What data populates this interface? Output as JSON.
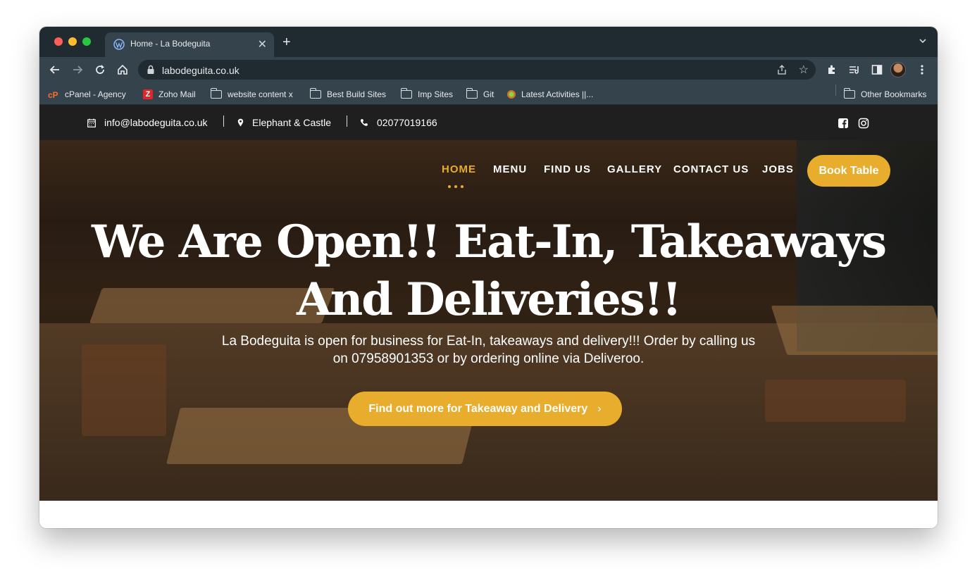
{
  "browser": {
    "tab_title": "Home - La Bodeguita",
    "new_tab_symbol": "+",
    "close_symbol": "✕",
    "url": "labodeguita.co.uk",
    "star_symbol": "☆",
    "bookmarks": [
      {
        "label": "cPanel - Agency",
        "icon": "cpanel-icon"
      },
      {
        "label": "Zoho Mail",
        "icon": "zoho-icon"
      },
      {
        "label": "website content x",
        "icon": "folder-icon"
      },
      {
        "label": "Best Build Sites",
        "icon": "folder-icon"
      },
      {
        "label": "Imp Sites",
        "icon": "folder-icon"
      },
      {
        "label": "Git",
        "icon": "folder-icon"
      },
      {
        "label": "Latest Activities ||...",
        "icon": "site-icon"
      }
    ],
    "other_bookmarks": "Other Bookmarks"
  },
  "topbar": {
    "email": "info@labodeguita.co.uk",
    "location": "Elephant & Castle",
    "phone": "02077019166"
  },
  "nav": {
    "items": [
      "HOME",
      "MENU",
      "FIND US",
      "GALLERY",
      "CONTACT US",
      "JOBS"
    ],
    "active": "HOME",
    "book_button": "Book Table"
  },
  "hero": {
    "title_line1": "We Are Open!! Eat-In, Takeaways",
    "title_line2": "And Deliveries!!",
    "subtitle_line1": "La Bodeguita is open for business for Eat-In, takeaways and delivery!!! Order by calling us",
    "subtitle_line2": "on 07958901353 or by ordering online via Deliveroo.",
    "cta_label": "Find out more for Takeaway and Delivery",
    "cta_chevron": "›"
  },
  "colors": {
    "accent": "#e8ad2c",
    "topbar_bg": "#1f1f1f",
    "chrome_dark": "#202a31",
    "chrome_toolbar": "#35434c"
  }
}
